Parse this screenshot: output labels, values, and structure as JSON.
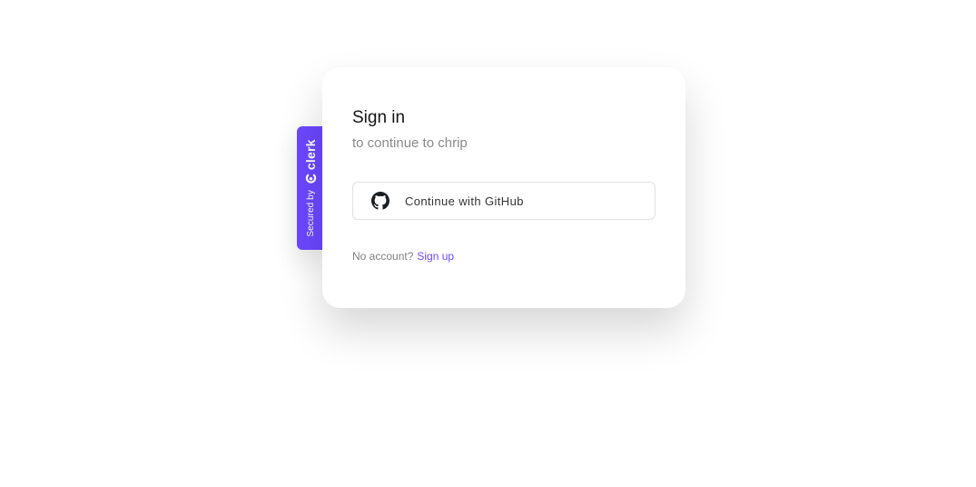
{
  "badge": {
    "secured_text": "Secured by",
    "brand": "clerk",
    "logo_icon": "clerk-logo-icon",
    "color": "#6c47ff"
  },
  "card": {
    "title": "Sign in",
    "subtitle": "to continue to chrip",
    "social_button": {
      "icon": "github-icon",
      "label": "Continue with GitHub"
    },
    "footer": {
      "prompt": "No account?",
      "link_label": "Sign up"
    }
  },
  "colors": {
    "accent": "#6c47ff",
    "title": "#151515",
    "muted": "#8a8a8a",
    "border": "#e2e2e2"
  }
}
